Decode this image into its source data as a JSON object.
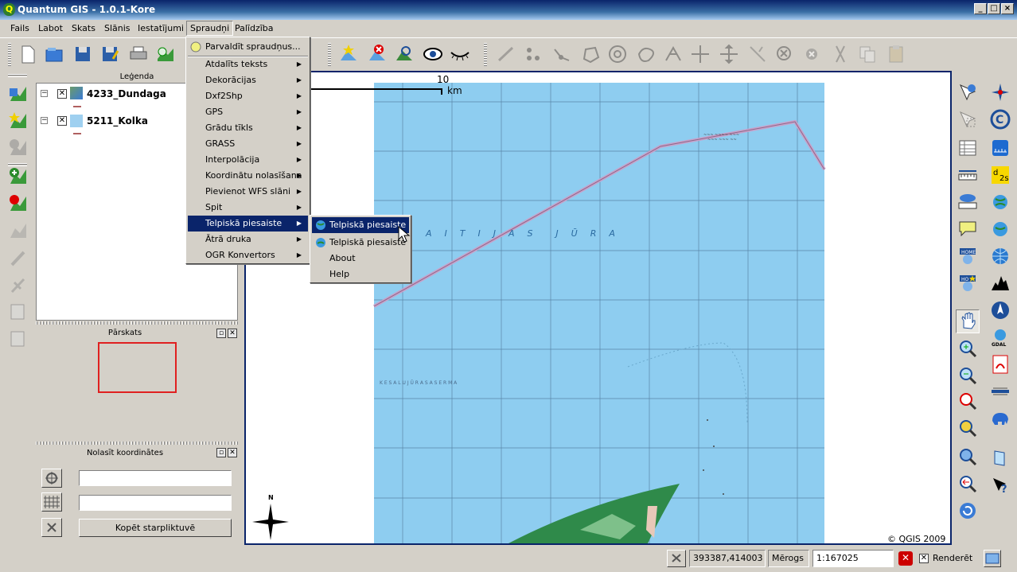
{
  "window": {
    "title": "Quantum GIS - 1.0.1-Kore"
  },
  "menubar": [
    "Fails",
    "Labot",
    "Skats",
    "Slānis",
    "Iestatījumi",
    "Spraudņi",
    "Palīdzība"
  ],
  "plugins_menu": {
    "top_item": "Parvaldīt spraudņus...",
    "items": [
      "Atdalīts teksts",
      "Dekorācijas",
      "Dxf2Shp",
      "GPS",
      "Grādu tīkls",
      "GRASS",
      "Interpolācija",
      "Koordinātu nolasīšana",
      "Pievienot WFS slāni",
      "Spit",
      "Telpiskā piesaiste",
      "Ātrā druka",
      "OGR Konvertors"
    ],
    "selected": "Telpiskā piesaiste"
  },
  "submenu": {
    "items": [
      "Telpiskā piesaiste",
      "Telpiskā piesaiste",
      "About",
      "Help"
    ]
  },
  "legend": {
    "title": "Leģenda",
    "layers": [
      "4233_Dundaga",
      "5211_Kolka"
    ]
  },
  "overview": {
    "title": "Pārskats"
  },
  "coord_panel": {
    "title": "Nolasīt koordinātes",
    "field1": "",
    "field2": "",
    "copy_button": "Kopēt starpliktuvē"
  },
  "map": {
    "scalebar_value": "10",
    "scalebar_unit": "km",
    "sea_label": "A  I  T  I  J  A  S    J  Ū  R  A",
    "north": "N",
    "copyright": "© QGIS 2009"
  },
  "statusbar": {
    "coords": "393387,414003",
    "scale_label": "Mērogs",
    "scale_value": "1:167025",
    "render_label": "Renderēt"
  }
}
